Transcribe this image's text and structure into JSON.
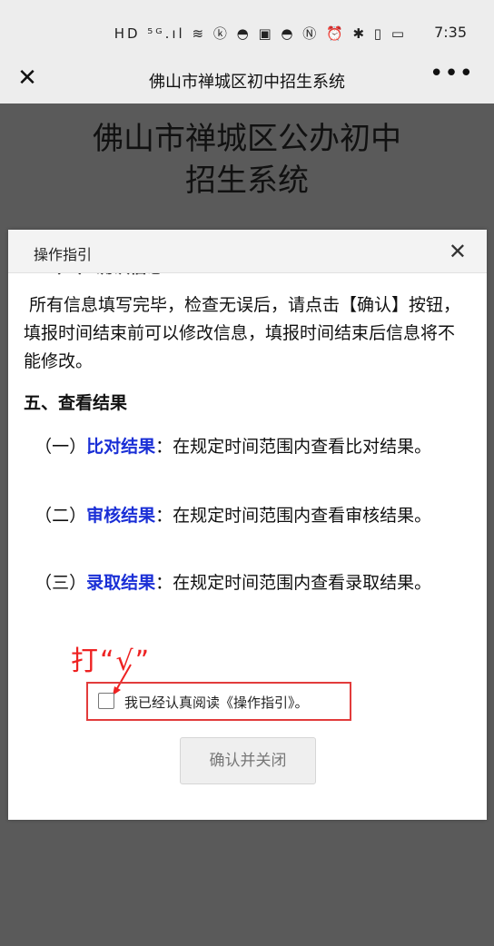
{
  "status_bar": {
    "icons": "HD ⁵ᴳ.ıl ≋ ⓚ ◓ ▣ ◓   Ⓝ ⏰ ✱ ▯ ▭",
    "time": "7:35"
  },
  "nav": {
    "close_icon": "✕",
    "title": "佛山市禅城区初中招生系统",
    "more_icon": "•••"
  },
  "page": {
    "title_line1": "佛山市禅城区公办初中",
    "title_line2": "招生系统"
  },
  "modal": {
    "title": "操作指引",
    "close_icon": "✕",
    "cut_heading": "（三）确认信息",
    "intro": "所有信息填写完毕，检查无误后，请点击【确认】按钮，填报时间结束前可以修改信息，填报时间结束后信息将不能修改。",
    "section_five": "五、查看结果",
    "items": [
      {
        "prefix": "（一）",
        "keyword": "比对结果",
        "text": "：在规定时间范围内查看比对结果。"
      },
      {
        "prefix": "（二）",
        "keyword": "审核结果",
        "text": "：在规定时间范围内查看审核结果。"
      },
      {
        "prefix": "（三）",
        "keyword": "录取结果",
        "text": "：在规定时间范围内查看录取结果。"
      }
    ],
    "annotation": "打“√”",
    "agree_label": "我已经认真阅读《操作指引》。",
    "confirm_label": "确认并关闭"
  },
  "colors": {
    "keyword": "#1a2fd6",
    "annotation": "#ee2222",
    "overlay": "#5a5a5a"
  }
}
